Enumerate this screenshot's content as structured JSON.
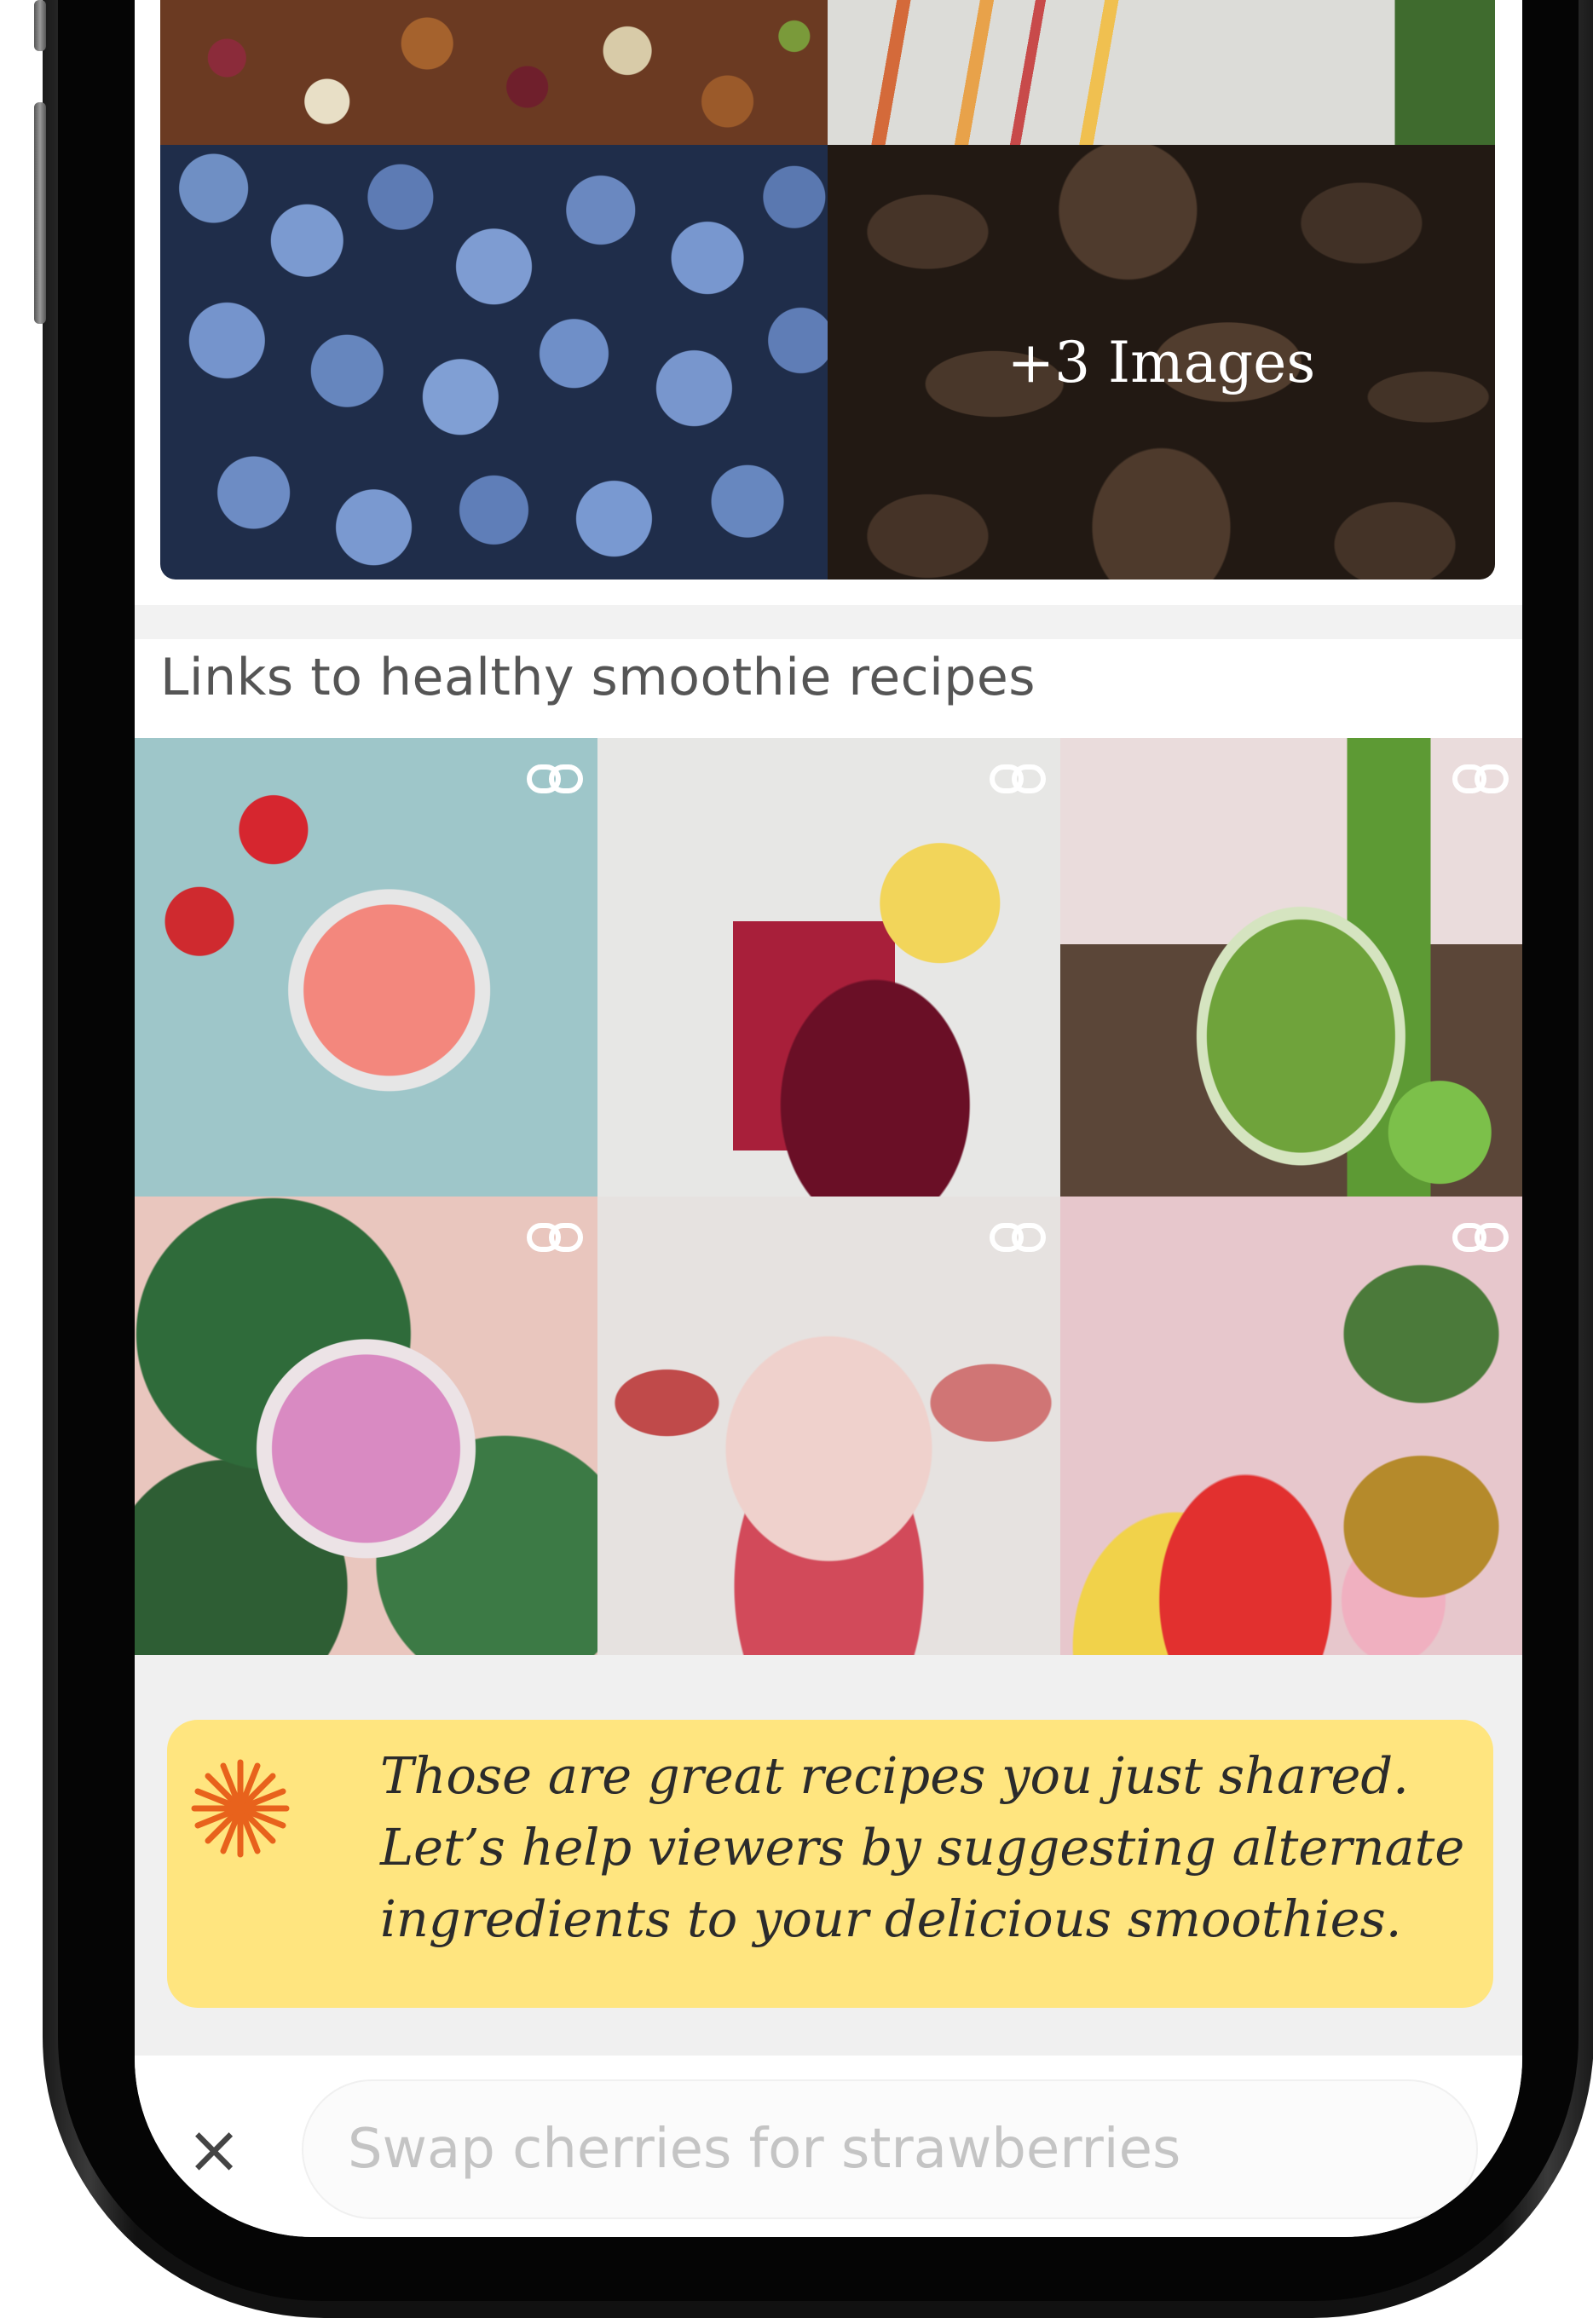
{
  "gallery": {
    "more_label": "+3 Images"
  },
  "section": {
    "title": "Links to healthy smoothie recipes"
  },
  "recipe_links": [
    {
      "icon": "link-icon"
    },
    {
      "icon": "link-icon"
    },
    {
      "icon": "link-icon"
    },
    {
      "icon": "link-icon"
    },
    {
      "icon": "link-icon"
    },
    {
      "icon": "link-icon"
    }
  ],
  "assistant": {
    "icon": "sparkle-icon",
    "lines": [
      "Those are great recipes you just shared.",
      "Let’s help viewers by suggesting alternate",
      "ingredients to your delicious smoothies."
    ],
    "background": "#ffe57f",
    "accent": "#e8621c"
  },
  "composer": {
    "close_label": "×",
    "placeholder": "Swap cherries for strawberries"
  }
}
